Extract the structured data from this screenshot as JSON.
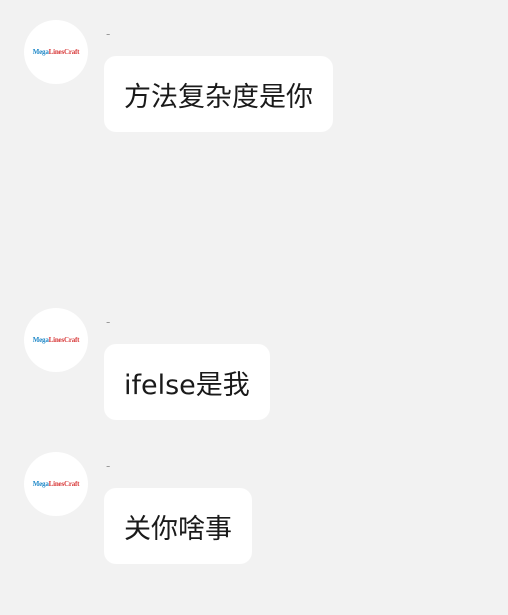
{
  "messages": [
    {
      "avatar_logo": [
        "Mega",
        "Lines",
        "Craft"
      ],
      "sender": "-",
      "text": "方法复杂度是你"
    },
    {
      "avatar_logo": [
        "Mega",
        "Lines",
        "Craft"
      ],
      "sender": "-",
      "text": "ifelse是我"
    },
    {
      "avatar_logo": [
        "Mega",
        "Lines",
        "Craft"
      ],
      "sender": "-",
      "text": "关你啥事"
    }
  ]
}
